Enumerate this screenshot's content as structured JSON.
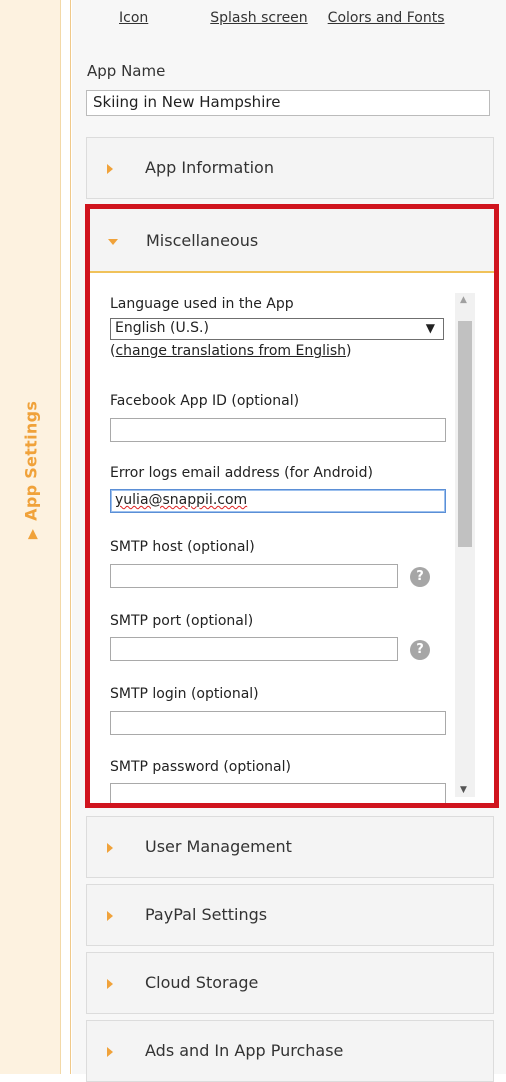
{
  "top_links": [
    "Icon",
    "Splash screen",
    "Colors and Fonts"
  ],
  "side_tab": {
    "label": "App Settings",
    "icon": "triangle-right-icon"
  },
  "app_name": {
    "label": "App Name",
    "value": "Skiing in New Hampshire"
  },
  "sections_before": [
    {
      "label": "App Information"
    }
  ],
  "miscellaneous": {
    "label": "Miscellaneous",
    "language": {
      "label": "Language used in the App",
      "selected": "English (U.S.)",
      "link_prefix": "(",
      "link_text": "change translations from English",
      "link_suffix": ")"
    },
    "fields": {
      "facebook": {
        "label": "Facebook App ID (optional)",
        "value": ""
      },
      "error_email": {
        "label": "Error logs email address (for Android)",
        "value": "yulia@snappii.com"
      },
      "smtp_host": {
        "label": "SMTP host (optional)",
        "value": ""
      },
      "smtp_port": {
        "label": "SMTP port (optional)",
        "value": ""
      },
      "smtp_login": {
        "label": "SMTP login (optional)",
        "value": ""
      },
      "smtp_password": {
        "label": "SMTP password (optional)",
        "value": ""
      }
    },
    "help_glyph": "?",
    "highlight_color": "#d0141e"
  },
  "sections_after": [
    {
      "label": "User Management"
    },
    {
      "label": "PayPal Settings"
    },
    {
      "label": "Cloud Storage"
    },
    {
      "label": "Ads and In App Purchase"
    }
  ],
  "colors": {
    "accent": "#f0a23a",
    "rail_bg": "#fdf2e0"
  }
}
